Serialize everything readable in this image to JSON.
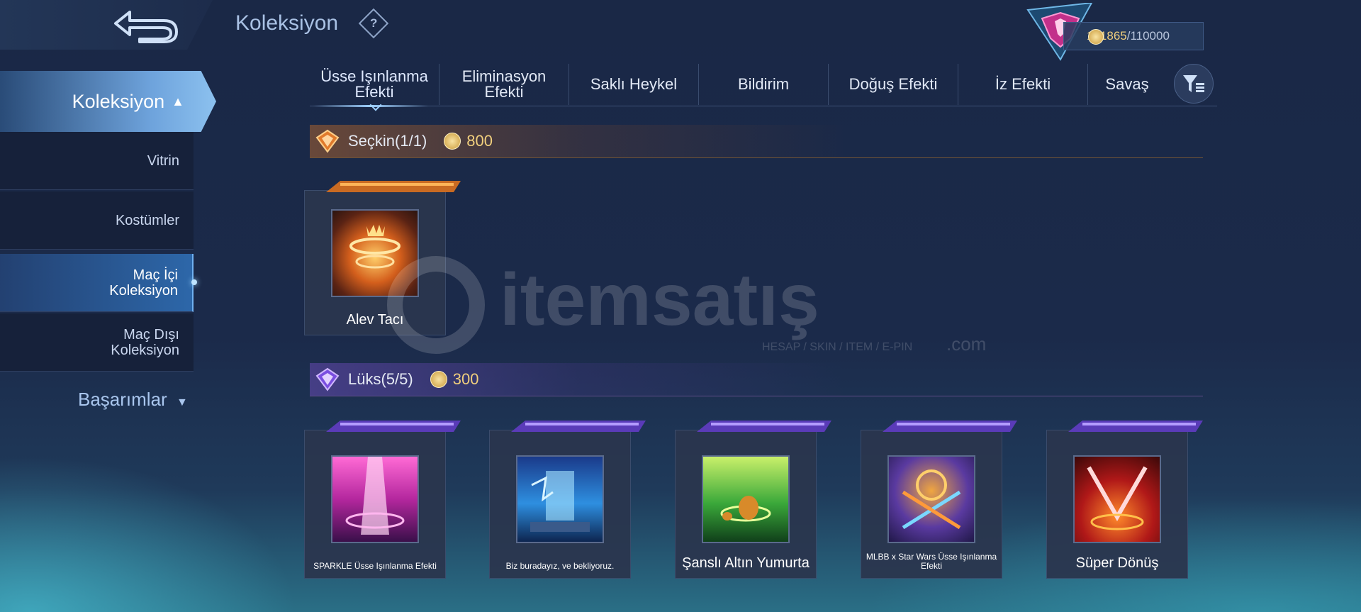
{
  "header": {
    "title": "Koleksiyon",
    "help_icon": "question-icon",
    "currency_value": "101865",
    "currency_max": "/110000",
    "currency_icon": "coin-icon"
  },
  "sidebar": {
    "main_label": "Koleksiyon",
    "items": [
      {
        "label": "Vitrin"
      },
      {
        "label": "Kostümler"
      },
      {
        "label": "Maç İçi Koleksiyon"
      },
      {
        "label": "Maç Dışı Koleksiyon"
      }
    ],
    "achievements_label": "Başarımlar"
  },
  "tabs": [
    {
      "label": "Üsse Işınlanma Efekti"
    },
    {
      "label": "Eliminasyon Efekti"
    },
    {
      "label": "Saklı Heykel"
    },
    {
      "label": "Bildirim"
    },
    {
      "label": "Doğuş Efekti"
    },
    {
      "label": "İz Efekti"
    },
    {
      "label": "Savaş"
    }
  ],
  "sections": {
    "elite": {
      "title": "Seçkin(1/1)",
      "price": "800",
      "color": "#e07a2c"
    },
    "lux": {
      "title": "Lüks(5/5)",
      "price": "300",
      "color": "#8a5cf0"
    }
  },
  "elite_items": [
    {
      "name": "Alev Tacı"
    }
  ],
  "lux_items": [
    {
      "name": "SPARKLE Üsse Işınlanma Efekti"
    },
    {
      "name": "Biz buradayız, ve bekliyoruz."
    },
    {
      "name": "Şanslı Altın Yumurta"
    },
    {
      "name": "MLBB x Star Wars Üsse Işınlanma Efekti"
    },
    {
      "name": "Süper Dönüş"
    }
  ],
  "watermark": {
    "brand": "itemsatış",
    "tagline": "HESAP / SKIN / ITEM / E-PIN",
    "domain": ".com"
  }
}
